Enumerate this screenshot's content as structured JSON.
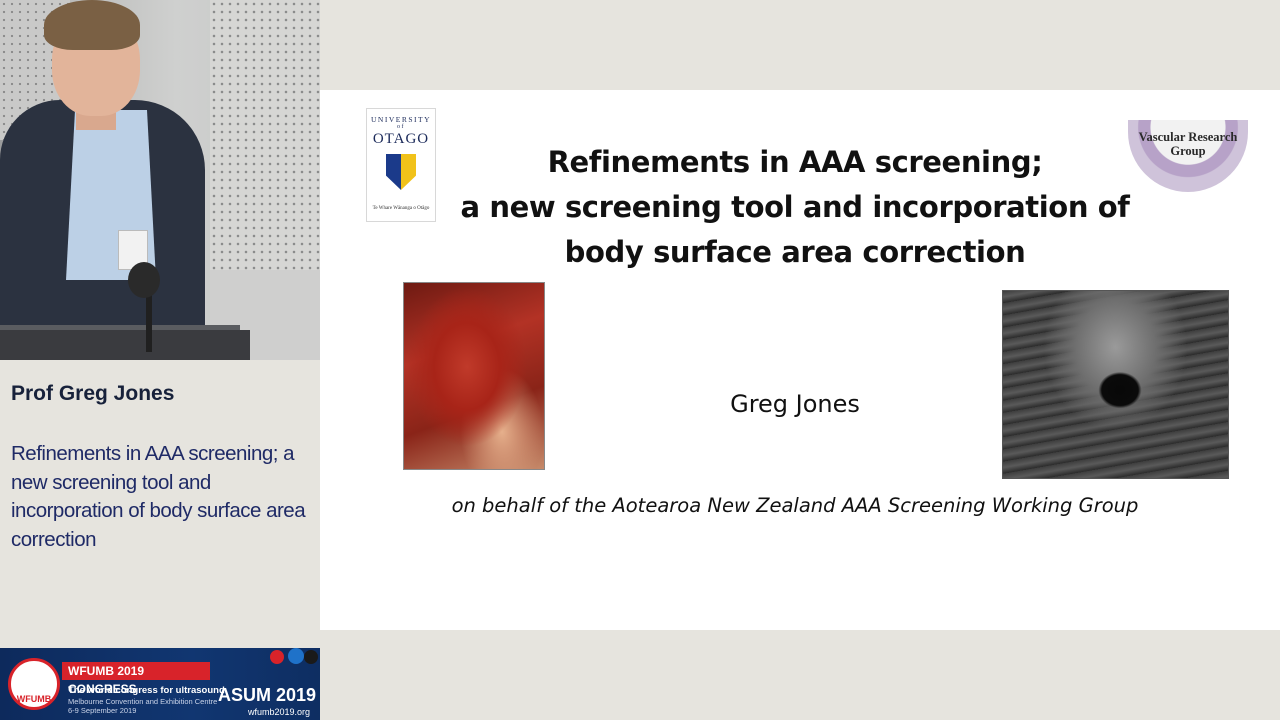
{
  "caption": {
    "speaker_name": "Prof Greg Jones",
    "talk_title": "Refinements in AAA screening; a new screening tool and incorporation of body surface area correction"
  },
  "banner": {
    "logo_text": "WFUMB",
    "congress": "WFUMB 2019 CONGRESS",
    "tagline": "The world congress for ultrasound",
    "venue_line1": "Melbourne Convention and Exhibition Centre",
    "venue_line2": "6-9 September 2019",
    "asum": "ASUM 2019",
    "website": "wfumb2019.org"
  },
  "slide": {
    "otago_logo": {
      "university": "UNIVERSITY",
      "of": "of",
      "name": "OTAGO",
      "motto": "Te Whare Wānanga o Otāgo"
    },
    "vrg_logo_text": "Vascular Research Group",
    "title_line1": "Refinements in AAA screening;",
    "title_line2": "a new screening tool and incorporation of",
    "title_line3": "body surface area correction",
    "presenter": "Greg Jones",
    "affiliation": "on behalf of the Aotearoa New Zealand AAA Screening Working Group"
  },
  "colors": {
    "caption_bg": "#e6e4de",
    "speaker_name": "#17213a",
    "talk_title": "#1f2a66",
    "banner_bg": "#113671",
    "banner_accent": "#d8232a"
  }
}
